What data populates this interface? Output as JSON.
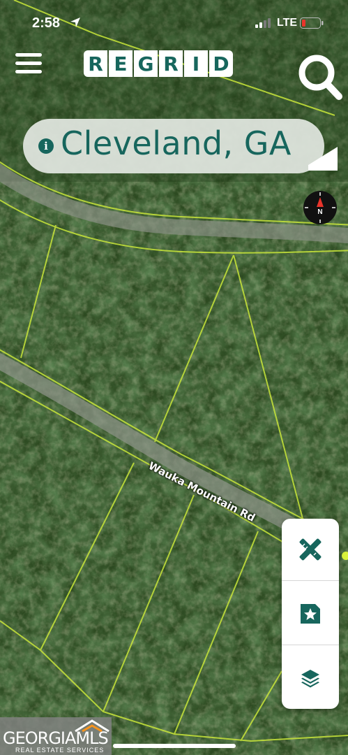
{
  "status_bar": {
    "time": "2:58",
    "network": "LTE"
  },
  "header": {
    "logo_letters": [
      "R",
      "E",
      "G",
      "R",
      "I",
      "D"
    ]
  },
  "location": {
    "name": "Cleveland, GA"
  },
  "compass": {
    "label": "N"
  },
  "map": {
    "road_label": "Wauka Mountain Rd"
  },
  "tools": [
    {
      "name": "draw-tool",
      "icon": "ruler-pencil-icon"
    },
    {
      "name": "saved-tool",
      "icon": "bookmark-star-icon"
    },
    {
      "name": "layers-tool",
      "icon": "layers-icon"
    }
  ],
  "watermark": {
    "name": "GEORGIAMLS",
    "subtitle": "REAL ESTATE SERVICES"
  },
  "colors": {
    "brand": "#17665d",
    "parcel_line": "#c9e63a",
    "battery_low": "#e8342b"
  }
}
